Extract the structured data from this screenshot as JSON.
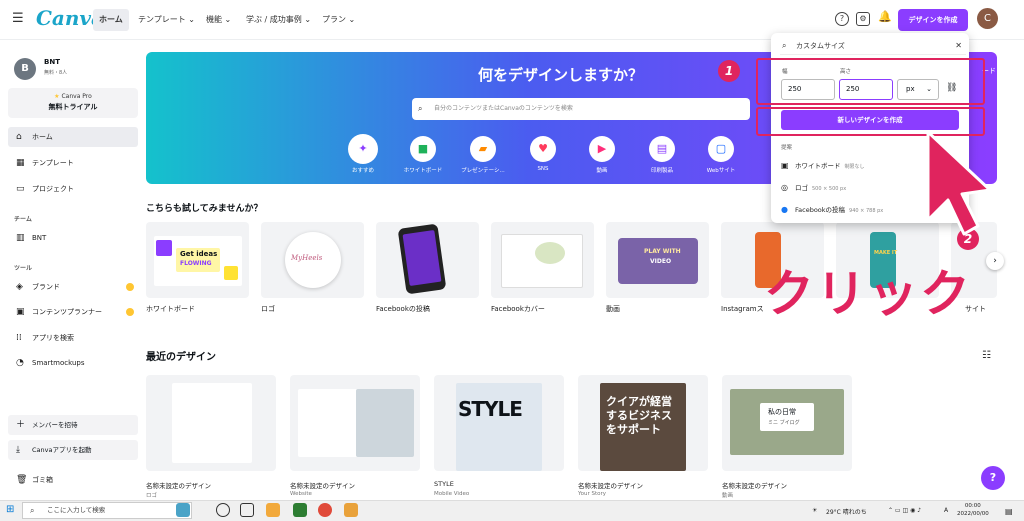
{
  "header": {
    "logo": "Canva",
    "nav": [
      "ホーム",
      "テンプレート",
      "機能",
      "学ぶ / 成功事例",
      "プラン"
    ],
    "create_button": "デザインを作成",
    "user_initial": "C",
    "icons": [
      "menu-icon",
      "help-icon",
      "settings-icon",
      "bell-icon"
    ]
  },
  "sidebar": {
    "team_initial": "B",
    "team_name": "BNT",
    "team_meta": "無料・8人",
    "pro_label": "Canva Pro",
    "pro_trial": "無料トライアル",
    "items": [
      {
        "label": "ホーム",
        "icon": "home-icon"
      },
      {
        "label": "テンプレート",
        "icon": "template-icon"
      },
      {
        "label": "プロジェクト",
        "icon": "folder-icon"
      }
    ],
    "team_section": "チーム",
    "team_item": "BNT",
    "tools_section": "ツール",
    "tools": [
      {
        "label": "ブランド",
        "icon": "brand-icon"
      },
      {
        "label": "コンテンツプランナー",
        "icon": "calendar-icon"
      },
      {
        "label": "アプリを検索",
        "icon": "apps-icon"
      },
      {
        "label": "Smartmockups",
        "icon": "mockup-icon"
      }
    ],
    "footer": [
      {
        "label": "メンバーを招待",
        "icon": "plus-icon"
      },
      {
        "label": "Canvaアプリを起動",
        "icon": "download-icon"
      },
      {
        "label": "ゴミ箱",
        "icon": "trash-icon"
      }
    ]
  },
  "hero": {
    "title": "何をデザインしますか？",
    "search_placeholder": "自分のコンテンツまたはCanvaのコンテンツを検索",
    "right_text": "ード",
    "categories": [
      {
        "label": "おすすめ",
        "icon": "sparkle-icon",
        "color": "#8b3dff"
      },
      {
        "label": "ホワイトボード",
        "icon": "whiteboard-icon",
        "color": "#1fb25a"
      },
      {
        "label": "プレゼンテーシ...",
        "icon": "presentation-icon",
        "color": "#ff8a00"
      },
      {
        "label": "SNS",
        "icon": "heart-icon",
        "color": "#ff3b5c"
      },
      {
        "label": "動画",
        "icon": "video-icon",
        "color": "#ff2e7a"
      },
      {
        "label": "印刷製品",
        "icon": "print-icon",
        "color": "#8b3dff"
      },
      {
        "label": "Webサイト",
        "icon": "web-icon",
        "color": "#1565ff"
      }
    ]
  },
  "try_section": {
    "title": "こちらも試してみませんか？",
    "cards": [
      "ホワイトボード",
      "ロゴ",
      "Facebookの投稿",
      "Facebookカバー",
      "動画",
      "Instagramス",
      "",
      "",
      "サイト"
    ],
    "texts": {
      "get_ideas": "Get ideas",
      "flowing": "FLOWING",
      "logo_script": "MyHeels",
      "play_with": "PLAY WITH",
      "video": "VIDEO",
      "make_it": "MAKE IT"
    }
  },
  "recent": {
    "title": "最近のデザイン",
    "items": [
      {
        "name": "名称未設定のデザイン",
        "type": "ロゴ"
      },
      {
        "name": "名称未設定のデザイン",
        "type": "Website"
      },
      {
        "name": "STYLE",
        "type": "Mobile Video"
      },
      {
        "name": "名称未設定のデザイン",
        "type": "Your Story"
      },
      {
        "name": "名称未設定のデザイン",
        "type": "動画"
      }
    ],
    "thumb_texts": {
      "style": "STYLE",
      "story": "クイアが経営するビジネスをサポート",
      "daily": "私の日常",
      "daily_sub": "ミニ ブイログ"
    }
  },
  "panel": {
    "search_value": "カスタムサイズ",
    "width_label": "幅",
    "height_label": "高さ",
    "width_value": "250",
    "height_value": "250",
    "unit": "px",
    "create_button": "新しいデザインを作成",
    "section": "提案",
    "suggestions": [
      {
        "label": "ホワイトボード",
        "size": "制限なし",
        "icon": "whiteboard-icon"
      },
      {
        "label": "ロゴ",
        "size": "500 × 500 px",
        "icon": "logo-icon"
      },
      {
        "label": "Facebookの投稿",
        "size": "940 × 788 px",
        "icon": "facebook-icon"
      }
    ]
  },
  "annotation": {
    "step1": "1",
    "step2": "2",
    "click_text": "クリック",
    "color": "#e0245e"
  },
  "help": "?",
  "taskbar": {
    "search_placeholder": "ここに入力して検索",
    "weather": "29°C 晴れのち",
    "lang": "A",
    "time": "00:00",
    "date": "2022/00/00"
  }
}
